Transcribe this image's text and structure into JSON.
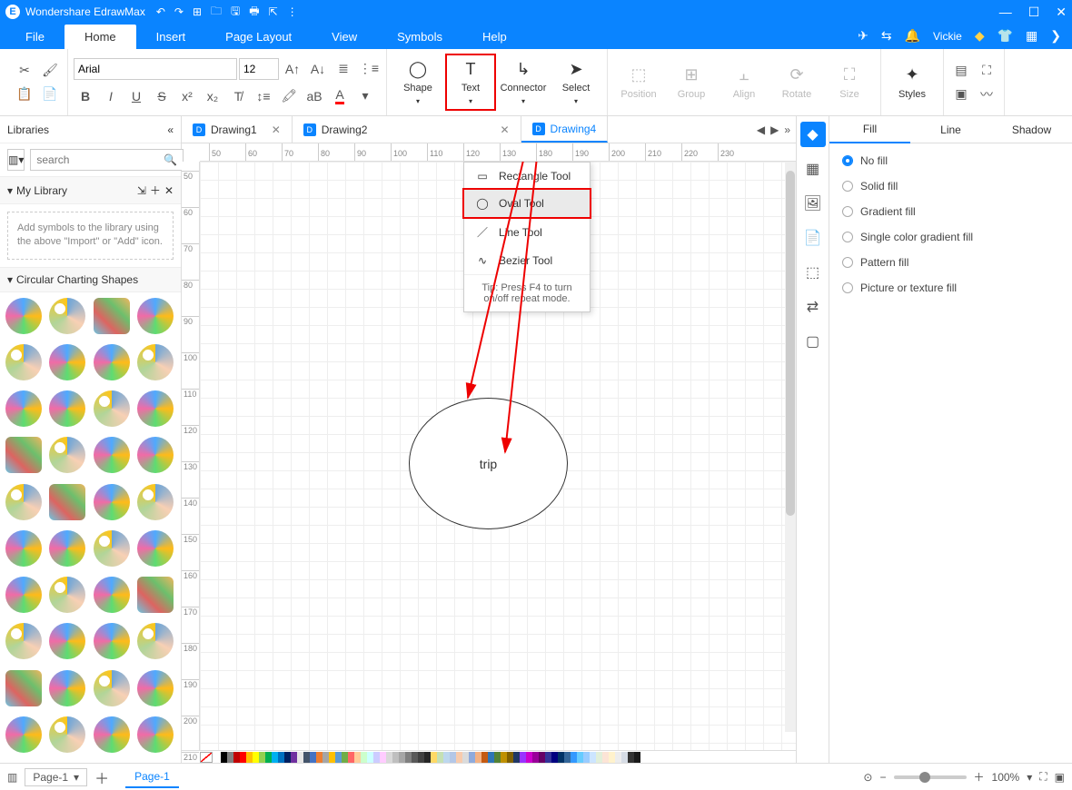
{
  "app": {
    "title": "Wondershare EdrawMax"
  },
  "user": {
    "name": "Vickie"
  },
  "menus": {
    "file": "File",
    "home": "Home",
    "insert": "Insert",
    "pageLayout": "Page Layout",
    "view": "View",
    "symbols": "Symbols",
    "help": "Help"
  },
  "ribbon": {
    "font": "Arial",
    "size": "12",
    "shape": "Shape",
    "text": "Text",
    "connector": "Connector",
    "select": "Select",
    "position": "Position",
    "group": "Group",
    "align": "Align",
    "rotate": "Rotate",
    "size2": "Size",
    "styles": "Styles"
  },
  "shapeMenu": {
    "rect": "Rectangle Tool",
    "oval": "Oval Tool",
    "line": "Line Tool",
    "bezier": "Bezier Tool",
    "hint": "Tip: Press F4 to turn on/off repeat mode."
  },
  "docTabs": {
    "d1": "Drawing1",
    "d2": "Drawing2",
    "d4": "Drawing4"
  },
  "libraries": {
    "title": "Libraries",
    "searchPlaceholder": "search",
    "myLibrary": "My Library",
    "hint": "Add symbols to the library using the above \"Import\" or \"Add\" icon.",
    "circular": "Circular Charting Shapes"
  },
  "canvas": {
    "shapeText": "trip"
  },
  "props": {
    "fill": "Fill",
    "line": "Line",
    "shadow": "Shadow",
    "noFill": "No fill",
    "solid": "Solid fill",
    "gradient": "Gradient fill",
    "singleGrad": "Single color gradient fill",
    "pattern": "Pattern fill",
    "picture": "Picture or texture fill"
  },
  "status": {
    "page": "Page-1",
    "pageTab": "Page-1",
    "zoom": "100%"
  },
  "rulerH": [
    "50",
    "60",
    "70",
    "80",
    "90",
    "100",
    "110",
    "120",
    "130",
    "180",
    "190",
    "200",
    "210",
    "220",
    "230"
  ],
  "rulerV": [
    "50",
    "60",
    "70",
    "80",
    "90",
    "100",
    "110",
    "120",
    "130",
    "140",
    "150",
    "160",
    "170",
    "180",
    "190",
    "200",
    "210"
  ],
  "palette": [
    "#fff",
    "#000",
    "#7f7f7f",
    "#c00000",
    "#ff0000",
    "#ffc000",
    "#ffff00",
    "#92d050",
    "#00b050",
    "#00b0f0",
    "#0070c0",
    "#002060",
    "#7030a0",
    "#e7e6e6",
    "#44546a",
    "#4472c4",
    "#ed7d31",
    "#a5a5a5",
    "#ffc000",
    "#5b9bd5",
    "#70ad47",
    "#ff6666",
    "#ffcc99",
    "#ccffcc",
    "#ccffff",
    "#ccccff",
    "#ffccff",
    "#d9d9d9",
    "#bfbfbf",
    "#a6a6a6",
    "#808080",
    "#595959",
    "#404040",
    "#262626",
    "#ffd966",
    "#c5e0b4",
    "#bdd7ee",
    "#b4c7e7",
    "#f8cbad",
    "#dbdbdb",
    "#8faadc",
    "#f4b183",
    "#c55a11",
    "#2e75b6",
    "#548235",
    "#bf9000",
    "#806000",
    "#203864",
    "#9933ff",
    "#cc00cc",
    "#990099",
    "#660066",
    "#333399",
    "#000080",
    "#003366",
    "#336699",
    "#3399ff",
    "#66ccff",
    "#99ccff",
    "#cce5ff",
    "#e1efda",
    "#fce4d6",
    "#fff2cc",
    "#ededed",
    "#d6dce5",
    "#333333",
    "#1a1a1a"
  ]
}
